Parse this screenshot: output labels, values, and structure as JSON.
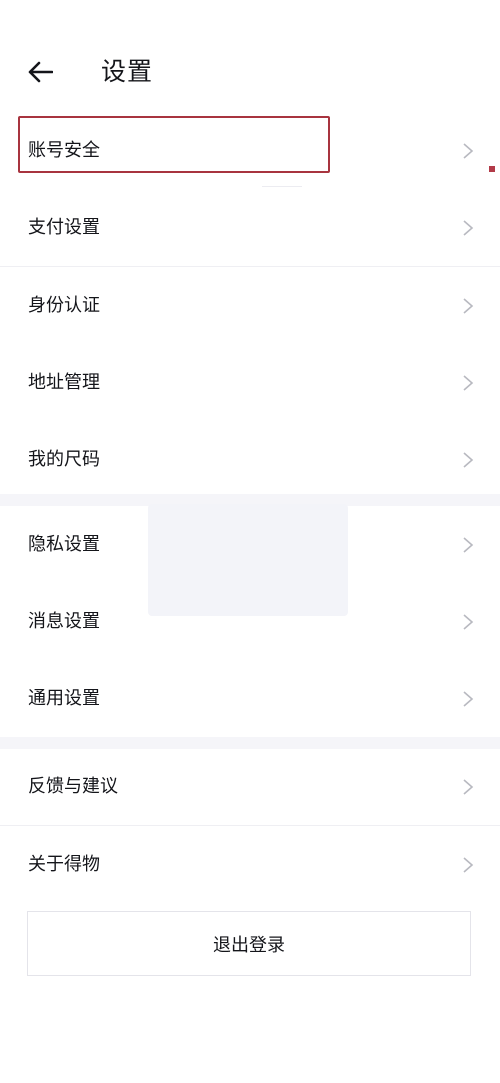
{
  "header": {
    "title": "设置"
  },
  "group1": [
    {
      "label": "账号安全"
    },
    {
      "label": "支付设置"
    },
    {
      "label": "身份认证"
    },
    {
      "label": "地址管理"
    },
    {
      "label": "我的尺码"
    }
  ],
  "group2": [
    {
      "label": "隐私设置"
    },
    {
      "label": "消息设置"
    },
    {
      "label": "通用设置"
    }
  ],
  "group3": [
    {
      "label": "反馈与建议"
    },
    {
      "label": "关于得物"
    }
  ],
  "logout": {
    "label": "退出登录"
  },
  "colors": {
    "highlight": "#a8343f",
    "chevron": "#b8b9c0",
    "divider_band": "#f5f5f9"
  }
}
